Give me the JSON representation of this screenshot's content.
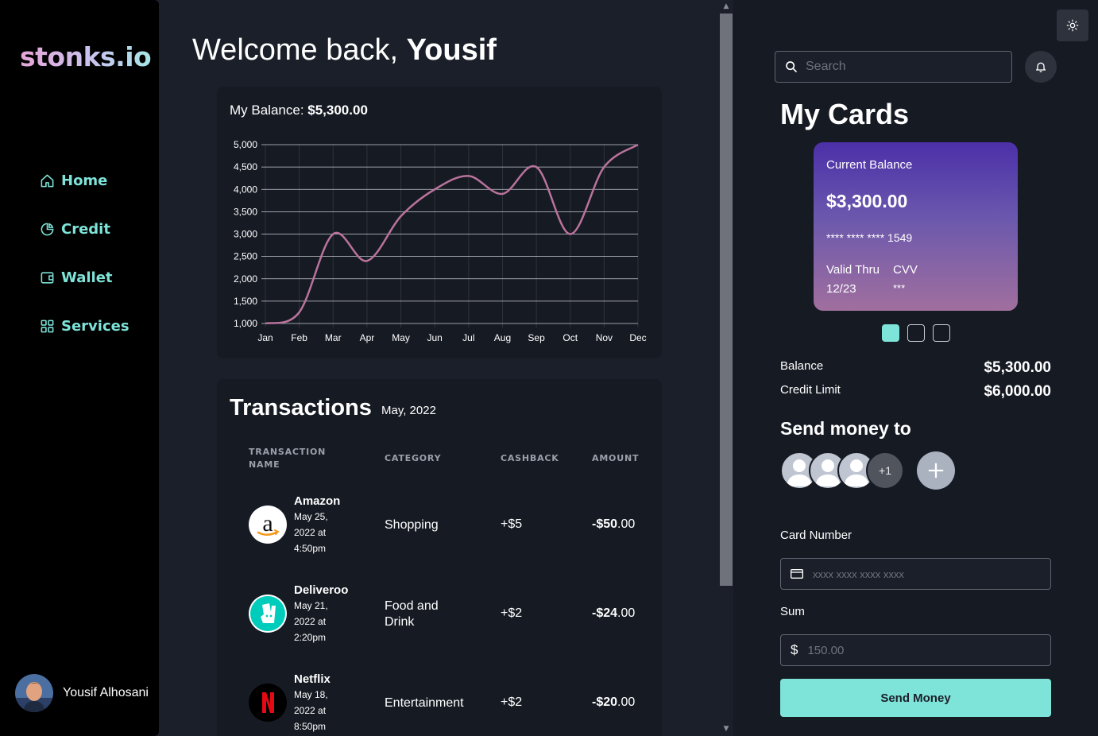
{
  "app": {
    "logo": "stonks.io"
  },
  "sidebar": {
    "items": [
      {
        "label": "Home",
        "icon": "home-icon"
      },
      {
        "label": "Credit",
        "icon": "pie-chart-icon"
      },
      {
        "label": "Wallet",
        "icon": "wallet-icon"
      },
      {
        "label": "Services",
        "icon": "grid-icon"
      }
    ],
    "user_name": "Yousif Alhosani"
  },
  "main": {
    "welcome_prefix": "Welcome back, ",
    "welcome_name": "Yousif",
    "balance_label": "My Balance: ",
    "balance_value": "$5,300.00"
  },
  "chart_data": {
    "type": "line",
    "categories": [
      "Jan",
      "Feb",
      "Mar",
      "Apr",
      "May",
      "Jun",
      "Jul",
      "Aug",
      "Sep",
      "Oct",
      "Nov",
      "Dec"
    ],
    "series": [
      {
        "values": [
          1000,
          1250,
          3000,
          2400,
          3400,
          4000,
          4300,
          3900,
          4500,
          3000,
          4500,
          5000
        ]
      }
    ],
    "ylim": [
      1000,
      5000
    ],
    "yticks": [
      "5,000",
      "4,500",
      "4,000",
      "3,500",
      "3,000",
      "2,500",
      "2,000",
      "1,500",
      "1,000"
    ],
    "grid": true,
    "line_color": "#b9739c"
  },
  "transactions": {
    "title": "Transactions",
    "period": "May, 2022",
    "headers": {
      "name_line1": "TRANSACTION",
      "name_line2": "NAME",
      "category": "CATEGORY",
      "cashback": "CASHBACK",
      "amount": "AMOUNT"
    },
    "rows": [
      {
        "name": "Amazon",
        "date1": "May 25,",
        "date2": "2022 at",
        "date3": "4:50pm",
        "category1": "Shopping",
        "category2": "",
        "cashback": "+$5",
        "amount_main": "-$50",
        "amount_cents": ".00",
        "logo": "amazon-logo"
      },
      {
        "name": "Deliveroo",
        "date1": "May 21,",
        "date2": "2022 at",
        "date3": "2:20pm",
        "category1": "Food and",
        "category2": "Drink",
        "cashback": "+$2",
        "amount_main": "-$24",
        "amount_cents": ".00",
        "logo": "deliveroo-logo"
      },
      {
        "name": "Netflix",
        "date1": "May 18,",
        "date2": "2022 at",
        "date3": "8:50pm",
        "category1": "Entertainment",
        "category2": "",
        "cashback": "+$2",
        "amount_main": "-$20",
        "amount_cents": ".00",
        "logo": "netflix-logo"
      }
    ]
  },
  "right": {
    "search_placeholder": "Search",
    "my_cards_title": "My Cards",
    "card": {
      "balance_label": "Current Balance",
      "balance_value": "$3,300.00",
      "number": "**** **** **** 1549",
      "valid_label": "Valid Thru",
      "valid_value": "12/23",
      "cvv_label": "CVV",
      "cvv_value": "***"
    },
    "balance_label": "Balance",
    "balance_value": "$5,300.00",
    "credit_label": "Credit Limit",
    "credit_value": "$6,000.00",
    "send_title": "Send money to",
    "contacts_more": "+1",
    "card_number_label": "Card Number",
    "card_number_placeholder": "xxxx xxxx xxxx xxxx",
    "sum_label": "Sum",
    "sum_placeholder": "150.00",
    "currency_symbol": "$",
    "send_button": "Send Money"
  },
  "colors": {
    "accent": "#7ee3d8",
    "chart_line": "#b9739c"
  }
}
